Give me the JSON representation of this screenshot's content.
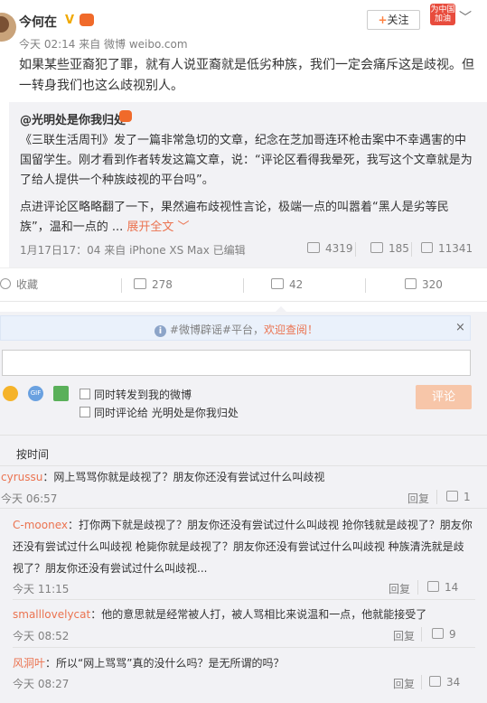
{
  "post": {
    "author": "今何在",
    "verified_mark": "V",
    "banner_text": "为中国加油",
    "follow_label": "关注",
    "follow_plus": "+",
    "meta": "今天 02:14 来自 微博 weibo.com",
    "text": "如果某些亚裔犯了罪，就有人说亚裔就是低劣种族，我们一定会痛斥这是歧视。但一转身我们也这么歧视别人。"
  },
  "repost": {
    "author": "@光明处是你我归处",
    "text1": "《三联生活周刊》发了一篇非常急切的文章，纪念在芝加哥连环枪击案中不幸遇害的中国留学生。刚才看到作者转发这篇文章，说：“评论区看得我晕死，我写这个文章就是为了给人提供一个种族歧视的平台吗”。",
    "text2": "点进评论区略略翻了一下，果然遍布歧视性言论，极端一点的叫嚣着“黑人是劣等民族”，温和一点的 ... ",
    "expand_label": "展开全文 ﹀",
    "meta": "1月17日17：04 来自 iPhone XS Max  已编辑",
    "reposts": "4319",
    "comments": "185",
    "likes": "11341"
  },
  "actions": {
    "favorite": "收藏",
    "repost": "278",
    "comment": "42",
    "like": "320"
  },
  "notice": {
    "icon": "i",
    "text_before": "#微博辟谣#平台，",
    "link_text": "欢迎查阅！",
    "close": "×"
  },
  "composer": {
    "input_value": "",
    "check1": "同时转发到我的微博",
    "check2": "同时评论给 光明处是你我归处",
    "submit": "评论",
    "gif_label": "GIF"
  },
  "sort_label": "按时间",
  "comments": [
    {
      "user": "cyrussu",
      "text": "：网上骂骂你就是歧视了？朋友你还没有尝试过什么叫歧视",
      "time": "今天 06:57",
      "reply": "回复",
      "likes": "1"
    },
    {
      "user": "C-moonex",
      "text": "：打你两下就是歧视了？朋友你还没有尝试过什么叫歧视 抢你钱就是歧视了？朋友你还没有尝试过什么叫歧视 枪毙你就是歧视了？朋友你还没有尝试过什么叫歧视 种族清洗就是歧视了？朋友你还没有尝试过什么叫歧视...",
      "time": "今天 11:15",
      "reply": "回复",
      "likes": "14"
    },
    {
      "user": "smalllovelycat",
      "text": "：他的意思就是经常被人打，被人骂相比来说温和一点，他就能接受了",
      "time": "今天 08:52",
      "reply": "回复",
      "likes": "9"
    },
    {
      "user": "风洞叶",
      "text": "：所以“网上骂骂”真的没什么吗？是无所谓的吗？",
      "time": "今天 08:27",
      "reply": "回复",
      "likes": "34"
    }
  ],
  "colors": {
    "accent": "#eb7350",
    "submit_disabled": "#f7c6a9",
    "background": "#f2f2f5"
  }
}
